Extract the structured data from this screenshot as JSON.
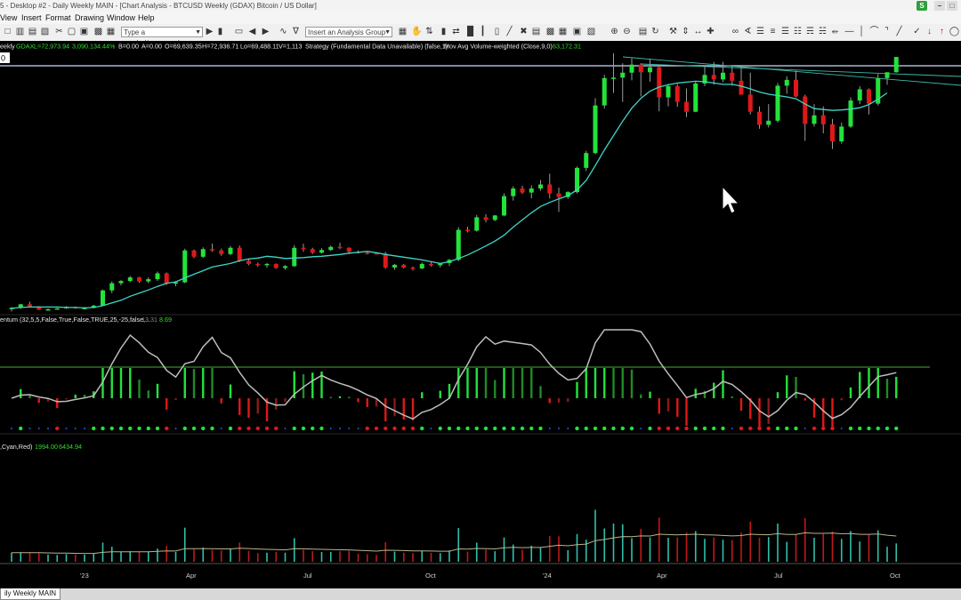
{
  "window": {
    "title": "5 - Desktop #2 - Daily Weekly MAIN - [Chart Analysis - BTCUSD Weekly (GDAX) Bitcoin / US Dollar]",
    "badge_s": "S",
    "badge_color": "#2e9e3e"
  },
  "menu": [
    "View",
    "Insert",
    "Format",
    "Drawing",
    "Window",
    "Help"
  ],
  "toolbar": {
    "symbol_placeholder": "Type a symbol/command",
    "analysis_group_placeholder": "Insert an Analysis Group"
  },
  "colors": {
    "bull": "#22e33a",
    "bear": "#e01818",
    "ma": "#3fd6c8",
    "momentum_line": "#bdbdbd",
    "hline": "#4a9e2a",
    "status_text_green": "#33dd33",
    "status_text_white": "#e8e8e8"
  },
  "price_panel": {
    "status_labels": [
      "eekly",
      "GDAX",
      "L=72,973.94",
      "3,090.13",
      "4.44%",
      "B=0.00",
      "A=0.00",
      "O=69,639.35",
      "H=72,936.71",
      "Lo=69,488.11",
      "V=1,113",
      "Strategy (Fundamental Data Unavailable) (false,1)",
      "Mov Avg Volume-weighted (Close,9,0)",
      "63,172.31"
    ],
    "price_tag": "0"
  },
  "momentum_panel": {
    "status_labels": [
      "entum (32,5,5,False,True,False,TRUE,25,-25,false,...",
      "13.31",
      "8.69"
    ]
  },
  "volume_panel": {
    "status_labels": [
      ",Cyan,Red)",
      "1994.00",
      "6434.94"
    ]
  },
  "x_axis": {
    "labels": [
      "'23",
      "Apr",
      "Jul",
      "Oct",
      "'24",
      "Apr",
      "Jul",
      "Oct"
    ]
  },
  "status_bar": {
    "tab_label": "ily Weekly MAIN"
  },
  "chart_data": {
    "type": "candlestick",
    "title": "BTCUSD Weekly (GDAX)",
    "y_label_last": "72,973.94",
    "candles": [
      [
        17.0,
        17.3,
        16.3,
        17.1
      ],
      [
        17.1,
        18.0,
        16.9,
        17.9
      ],
      [
        17.9,
        18.5,
        17.4,
        17.4
      ],
      [
        17.4,
        17.5,
        16.6,
        16.7
      ],
      [
        16.7,
        17.0,
        16.5,
        16.8
      ],
      [
        16.8,
        17.1,
        16.7,
        17.0
      ],
      [
        17.0,
        17.5,
        16.9,
        17.3
      ],
      [
        17.3,
        17.4,
        16.9,
        17.0
      ],
      [
        17.0,
        17.3,
        16.8,
        17.1
      ],
      [
        17.1,
        17.8,
        17.0,
        17.6
      ],
      [
        17.6,
        21.2,
        17.5,
        21.0
      ],
      [
        21.0,
        23.0,
        20.4,
        22.6
      ],
      [
        22.6,
        23.3,
        22.1,
        23.1
      ],
      [
        23.1,
        24.2,
        22.8,
        23.9
      ],
      [
        23.9,
        24.0,
        22.7,
        23.0
      ],
      [
        23.0,
        23.9,
        22.6,
        23.5
      ],
      [
        23.5,
        25.2,
        23.1,
        24.8
      ],
      [
        24.8,
        25.0,
        22.2,
        22.5
      ],
      [
        22.5,
        23.1,
        21.9,
        22.8
      ],
      [
        22.8,
        30.3,
        22.6,
        29.9
      ],
      [
        29.9,
        30.1,
        28.2,
        28.5
      ],
      [
        28.5,
        30.6,
        28.2,
        30.2
      ],
      [
        30.2,
        31.4,
        29.6,
        29.9
      ],
      [
        29.9,
        30.3,
        28.7,
        29.1
      ],
      [
        29.1,
        30.9,
        28.8,
        30.5
      ],
      [
        30.5,
        31.0,
        27.3,
        27.6
      ],
      [
        27.6,
        28.1,
        26.6,
        26.9
      ],
      [
        26.9,
        27.2,
        26.3,
        26.8
      ],
      [
        26.8,
        27.1,
        26.1,
        26.9
      ],
      [
        26.9,
        27.0,
        25.8,
        26.0
      ],
      [
        26.0,
        26.6,
        25.6,
        26.4
      ],
      [
        26.4,
        31.1,
        26.2,
        30.5
      ],
      [
        30.5,
        31.4,
        29.6,
        30.2
      ],
      [
        30.2,
        30.5,
        29.1,
        29.4
      ],
      [
        29.4,
        30.4,
        29.2,
        30.0
      ],
      [
        30.0,
        31.0,
        29.8,
        30.7
      ],
      [
        30.7,
        31.6,
        30.2,
        30.5
      ],
      [
        30.5,
        30.6,
        29.1,
        29.6
      ],
      [
        29.6,
        29.9,
        29.2,
        29.4
      ],
      [
        29.4,
        29.6,
        29.0,
        29.3
      ],
      [
        29.3,
        29.5,
        29.1,
        29.2
      ],
      [
        29.2,
        29.6,
        25.8,
        26.1
      ],
      [
        26.1,
        26.9,
        25.6,
        26.7
      ],
      [
        26.7,
        26.9,
        25.9,
        26.1
      ],
      [
        26.1,
        26.3,
        25.4,
        25.9
      ],
      [
        25.9,
        27.2,
        25.7,
        26.9
      ],
      [
        26.9,
        27.3,
        26.3,
        26.6
      ],
      [
        26.6,
        27.0,
        26.1,
        27.1
      ],
      [
        27.1,
        28.0,
        26.4,
        27.8
      ],
      [
        27.8,
        35.1,
        27.5,
        34.5
      ],
      [
        34.5,
        35.2,
        33.9,
        34.3
      ],
      [
        34.3,
        37.8,
        34.1,
        37.3
      ],
      [
        37.3,
        38.0,
        36.2,
        36.7
      ],
      [
        36.7,
        37.8,
        36.4,
        37.7
      ],
      [
        37.7,
        42.6,
        37.5,
        42.0
      ],
      [
        42.0,
        44.2,
        41.0,
        43.7
      ],
      [
        43.7,
        44.3,
        42.5,
        42.8
      ],
      [
        42.8,
        44.4,
        41.5,
        43.7
      ],
      [
        43.7,
        45.6,
        43.2,
        44.6
      ],
      [
        44.6,
        47.0,
        41.5,
        42.6
      ],
      [
        42.6,
        43.9,
        38.5,
        41.8
      ],
      [
        41.8,
        43.1,
        41.4,
        42.9
      ],
      [
        42.9,
        48.6,
        42.6,
        48.3
      ],
      [
        48.3,
        52.1,
        47.6,
        51.6
      ],
      [
        51.6,
        63.8,
        51.3,
        62.2
      ],
      [
        62.2,
        69.0,
        61.5,
        68.3
      ],
      [
        68.3,
        73.8,
        65.0,
        68.4
      ],
      [
        68.4,
        71.6,
        63.0,
        69.5
      ],
      [
        69.5,
        72.7,
        67.8,
        71.3
      ],
      [
        71.3,
        71.6,
        64.2,
        69.6
      ],
      [
        69.6,
        72.6,
        67.5,
        70.7
      ],
      [
        70.7,
        71.3,
        60.9,
        64.0
      ],
      [
        64.0,
        67.0,
        62.0,
        66.5
      ],
      [
        66.5,
        67.0,
        61.9,
        63.0
      ],
      [
        63.0,
        66.0,
        59.6,
        60.8
      ],
      [
        60.8,
        67.5,
        60.7,
        67.1
      ],
      [
        67.1,
        71.2,
        66.5,
        69.0
      ],
      [
        69.0,
        71.9,
        66.8,
        68.0
      ],
      [
        68.0,
        71.9,
        67.4,
        69.5
      ],
      [
        69.5,
        71.0,
        66.6,
        67.7
      ],
      [
        67.7,
        71.0,
        64.6,
        64.6
      ],
      [
        64.6,
        69.5,
        60.2,
        60.8
      ],
      [
        60.8,
        62.0,
        57.0,
        57.9
      ],
      [
        57.9,
        62.5,
        57.3,
        58.8
      ],
      [
        58.8,
        67.2,
        58.4,
        66.6
      ],
      [
        66.6,
        68.7,
        64.8,
        67.9
      ],
      [
        67.9,
        70.0,
        64.0,
        64.2
      ],
      [
        64.2,
        64.6,
        54.3,
        58.1
      ],
      [
        58.1,
        62.5,
        57.5,
        60.0
      ],
      [
        60.0,
        62.0,
        56.0,
        58.0
      ],
      [
        58.0,
        59.2,
        52.5,
        54.2
      ],
      [
        54.2,
        58.4,
        53.7,
        57.5
      ],
      [
        57.5,
        64.0,
        57.2,
        63.3
      ],
      [
        63.3,
        66.5,
        62.5,
        65.8
      ],
      [
        65.8,
        66.0,
        60.2,
        62.6
      ],
      [
        62.6,
        69.2,
        62.2,
        68.3
      ],
      [
        68.3,
        69.4,
        66.8,
        69.6
      ],
      [
        69.6,
        73.0,
        69.5,
        73.0
      ]
    ],
    "ma9": [
      17.0,
      17.2,
      17.3,
      17.3,
      17.3,
      17.3,
      17.2,
      17.2,
      17.1,
      17.2,
      17.6,
      18.2,
      18.8,
      19.7,
      20.4,
      21.1,
      21.9,
      22.6,
      22.9,
      23.8,
      24.6,
      25.4,
      26.2,
      26.6,
      27.0,
      27.6,
      28.0,
      28.2,
      28.6,
      28.4,
      28.1,
      28.2,
      28.3,
      28.5,
      28.6,
      28.8,
      29.0,
      29.3,
      29.5,
      29.7,
      29.4,
      29.0,
      28.7,
      28.4,
      28.1,
      27.8,
      27.4,
      27.0,
      27.4,
      28.1,
      28.9,
      29.9,
      30.9,
      32.0,
      33.3,
      35.1,
      36.7,
      38.3,
      39.7,
      40.6,
      41.4,
      42.1,
      43.4,
      45.5,
      48.8,
      52.3,
      55.5,
      58.7,
      61.6,
      63.8,
      65.4,
      66.3,
      66.8,
      67.2,
      67.4,
      67.6,
      67.5,
      67.2,
      66.9,
      66.9,
      66.5,
      65.9,
      65.2,
      64.7,
      64.4,
      64.1,
      63.7,
      62.5,
      61.5,
      61.3,
      61.1,
      61.2,
      61.4,
      61.7,
      62.4,
      63.6,
      65.0
    ]
  }
}
